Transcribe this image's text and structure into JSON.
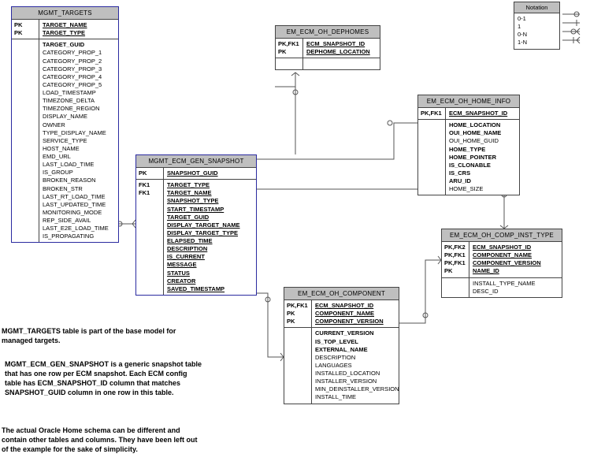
{
  "entities": {
    "mgmt_targets": {
      "title": "MGMT_TARGETS",
      "pk_left": [
        "PK",
        "PK"
      ],
      "pk_right": [
        "TARGET_NAME",
        "TARGET_TYPE"
      ],
      "attrs_left": [
        ""
      ],
      "attrs_right": [
        "TARGET_GUID",
        "CATEGORY_PROP_1",
        "CATEGORY_PROP_2",
        "CATEGORY_PROP_3",
        "CATEGORY_PROP_4",
        "CATEGORY_PROP_5",
        "LOAD_TIMESTAMP",
        "TIMEZONE_DELTA",
        "TIMEZONE_REGION",
        "DISPLAY_NAME",
        "OWNER",
        "TYPE_DISPLAY_NAME",
        "SERVICE_TYPE",
        "HOST_NAME",
        "EMD_URL",
        "LAST_LOAD_TIME",
        "IS_GROUP",
        "BROKEN_REASON",
        "BROKEN_STR",
        "LAST_RT_LOAD_TIME",
        "LAST_UPDATED_TIME",
        "MONITORING_MODE",
        "REP_SIDE_AVAIL",
        "LAST_E2E_LOAD_TIME",
        "IS_PROPAGATING"
      ]
    },
    "mgmt_ecm_gen_snapshot": {
      "title": "MGMT_ECM_GEN_SNAPSHOT",
      "pk_left": [
        "PK"
      ],
      "pk_right": [
        "SNAPSHOT_GUID"
      ],
      "attrs_left": [
        "FK1",
        "FK1",
        "-",
        "-",
        "-",
        "-",
        "-",
        "-",
        "-",
        "-",
        "-",
        "-",
        "-",
        "-"
      ],
      "attrs_right": [
        "TARGET_TYPE",
        "TARGET_NAME",
        "SNAPSHOT_TYPE",
        "START_TIMESTAMP",
        "TARGET_GUID",
        "DISPLAY_TARGET_NAME",
        "DISPLAY_TARGET_TYPE",
        "ELAPSED_TIME",
        "DESCRIPTION",
        "IS_CURRENT",
        "MESSAGE",
        "STATUS",
        "CREATOR",
        "SAVED_TIMESTAMP"
      ]
    },
    "em_ecm_oh_dephomes": {
      "title": "EM_ECM_OH_DEPHOMES",
      "pk_left": [
        "PK,FK1",
        "PK"
      ],
      "pk_right": [
        "ECM_SNAPSHOT_ID",
        "DEPHOME_LOCATION"
      ]
    },
    "em_ecm_oh_home_info": {
      "title": "EM_ECM_OH_HOME_INFO",
      "pk_left": [
        "PK,FK1"
      ],
      "pk_right": [
        "ECM_SNAPSHOT_ID"
      ],
      "attrs_right": [
        "HOME_LOCATION",
        "OUI_HOME_NAME",
        "OUI_HOME_GUID",
        "HOME_TYPE",
        "HOME_POINTER",
        "IS_CLONABLE",
        "IS_CRS",
        "ARU_ID",
        "HOME_SIZE"
      ],
      "attrs_bold": {
        "HOME_LOCATION": true,
        "OUI_HOME_NAME": true,
        "HOME_TYPE": true,
        "HOME_POINTER": true,
        "IS_CLONABLE": true,
        "IS_CRS": true,
        "ARU_ID": true
      }
    },
    "em_ecm_oh_component": {
      "title": "EM_ECM_OH_COMPONENT",
      "pk_left": [
        "PK,FK1",
        "PK",
        "PK"
      ],
      "pk_right": [
        "ECM_SNAPSHOT_ID",
        "COMPONENT_NAME",
        "COMPONENT_VERSION"
      ],
      "attrs_right": [
        "CURRENT_VERSION",
        "IS_TOP_LEVEL",
        "EXTERNAL_NAME",
        "DESCRIPTION",
        "LANGUAGES",
        "INSTALLED_LOCATION",
        "INSTALLER_VERSION",
        "MIN_DEINSTALLER_VERSION",
        "INSTALL_TIME"
      ],
      "attrs_bold": {
        "CURRENT_VERSION": true,
        "IS_TOP_LEVEL": true,
        "EXTERNAL_NAME": true
      }
    },
    "em_ecm_oh_comp_inst_type": {
      "title": "EM_ECM_OH_COMP_INST_TYPE",
      "pk_left": [
        "PK,FK2",
        "PK,FK1",
        "PK,FK1",
        "PK"
      ],
      "pk_right": [
        "ECM_SNAPSHOT_ID",
        "COMPONENT_NAME",
        "COMPONENT_VERSION",
        "NAME_ID"
      ],
      "attrs_right": [
        "INSTALL_TYPE_NAME",
        "DESC_ID"
      ]
    }
  },
  "descriptions": {
    "d1": "MGMT_TARGETS table is part of the base model for managed targets.",
    "d2": "MGMT_ECM_GEN_SNAPSHOT is a generic snapshot table that has one row per ECM snapshot. Each ECM config table has ECM_SNAPSHOT_ID column that matches SNAPSHOT_GUID column in one row in this table.",
    "d3": "The actual Oracle Home schema can be different and contain other tables and columns. They have been left out of the example for the sake of simplicity."
  },
  "notation": {
    "title": "Notation",
    "rows": [
      "0-1",
      "1",
      "0-N",
      "1-N"
    ]
  }
}
